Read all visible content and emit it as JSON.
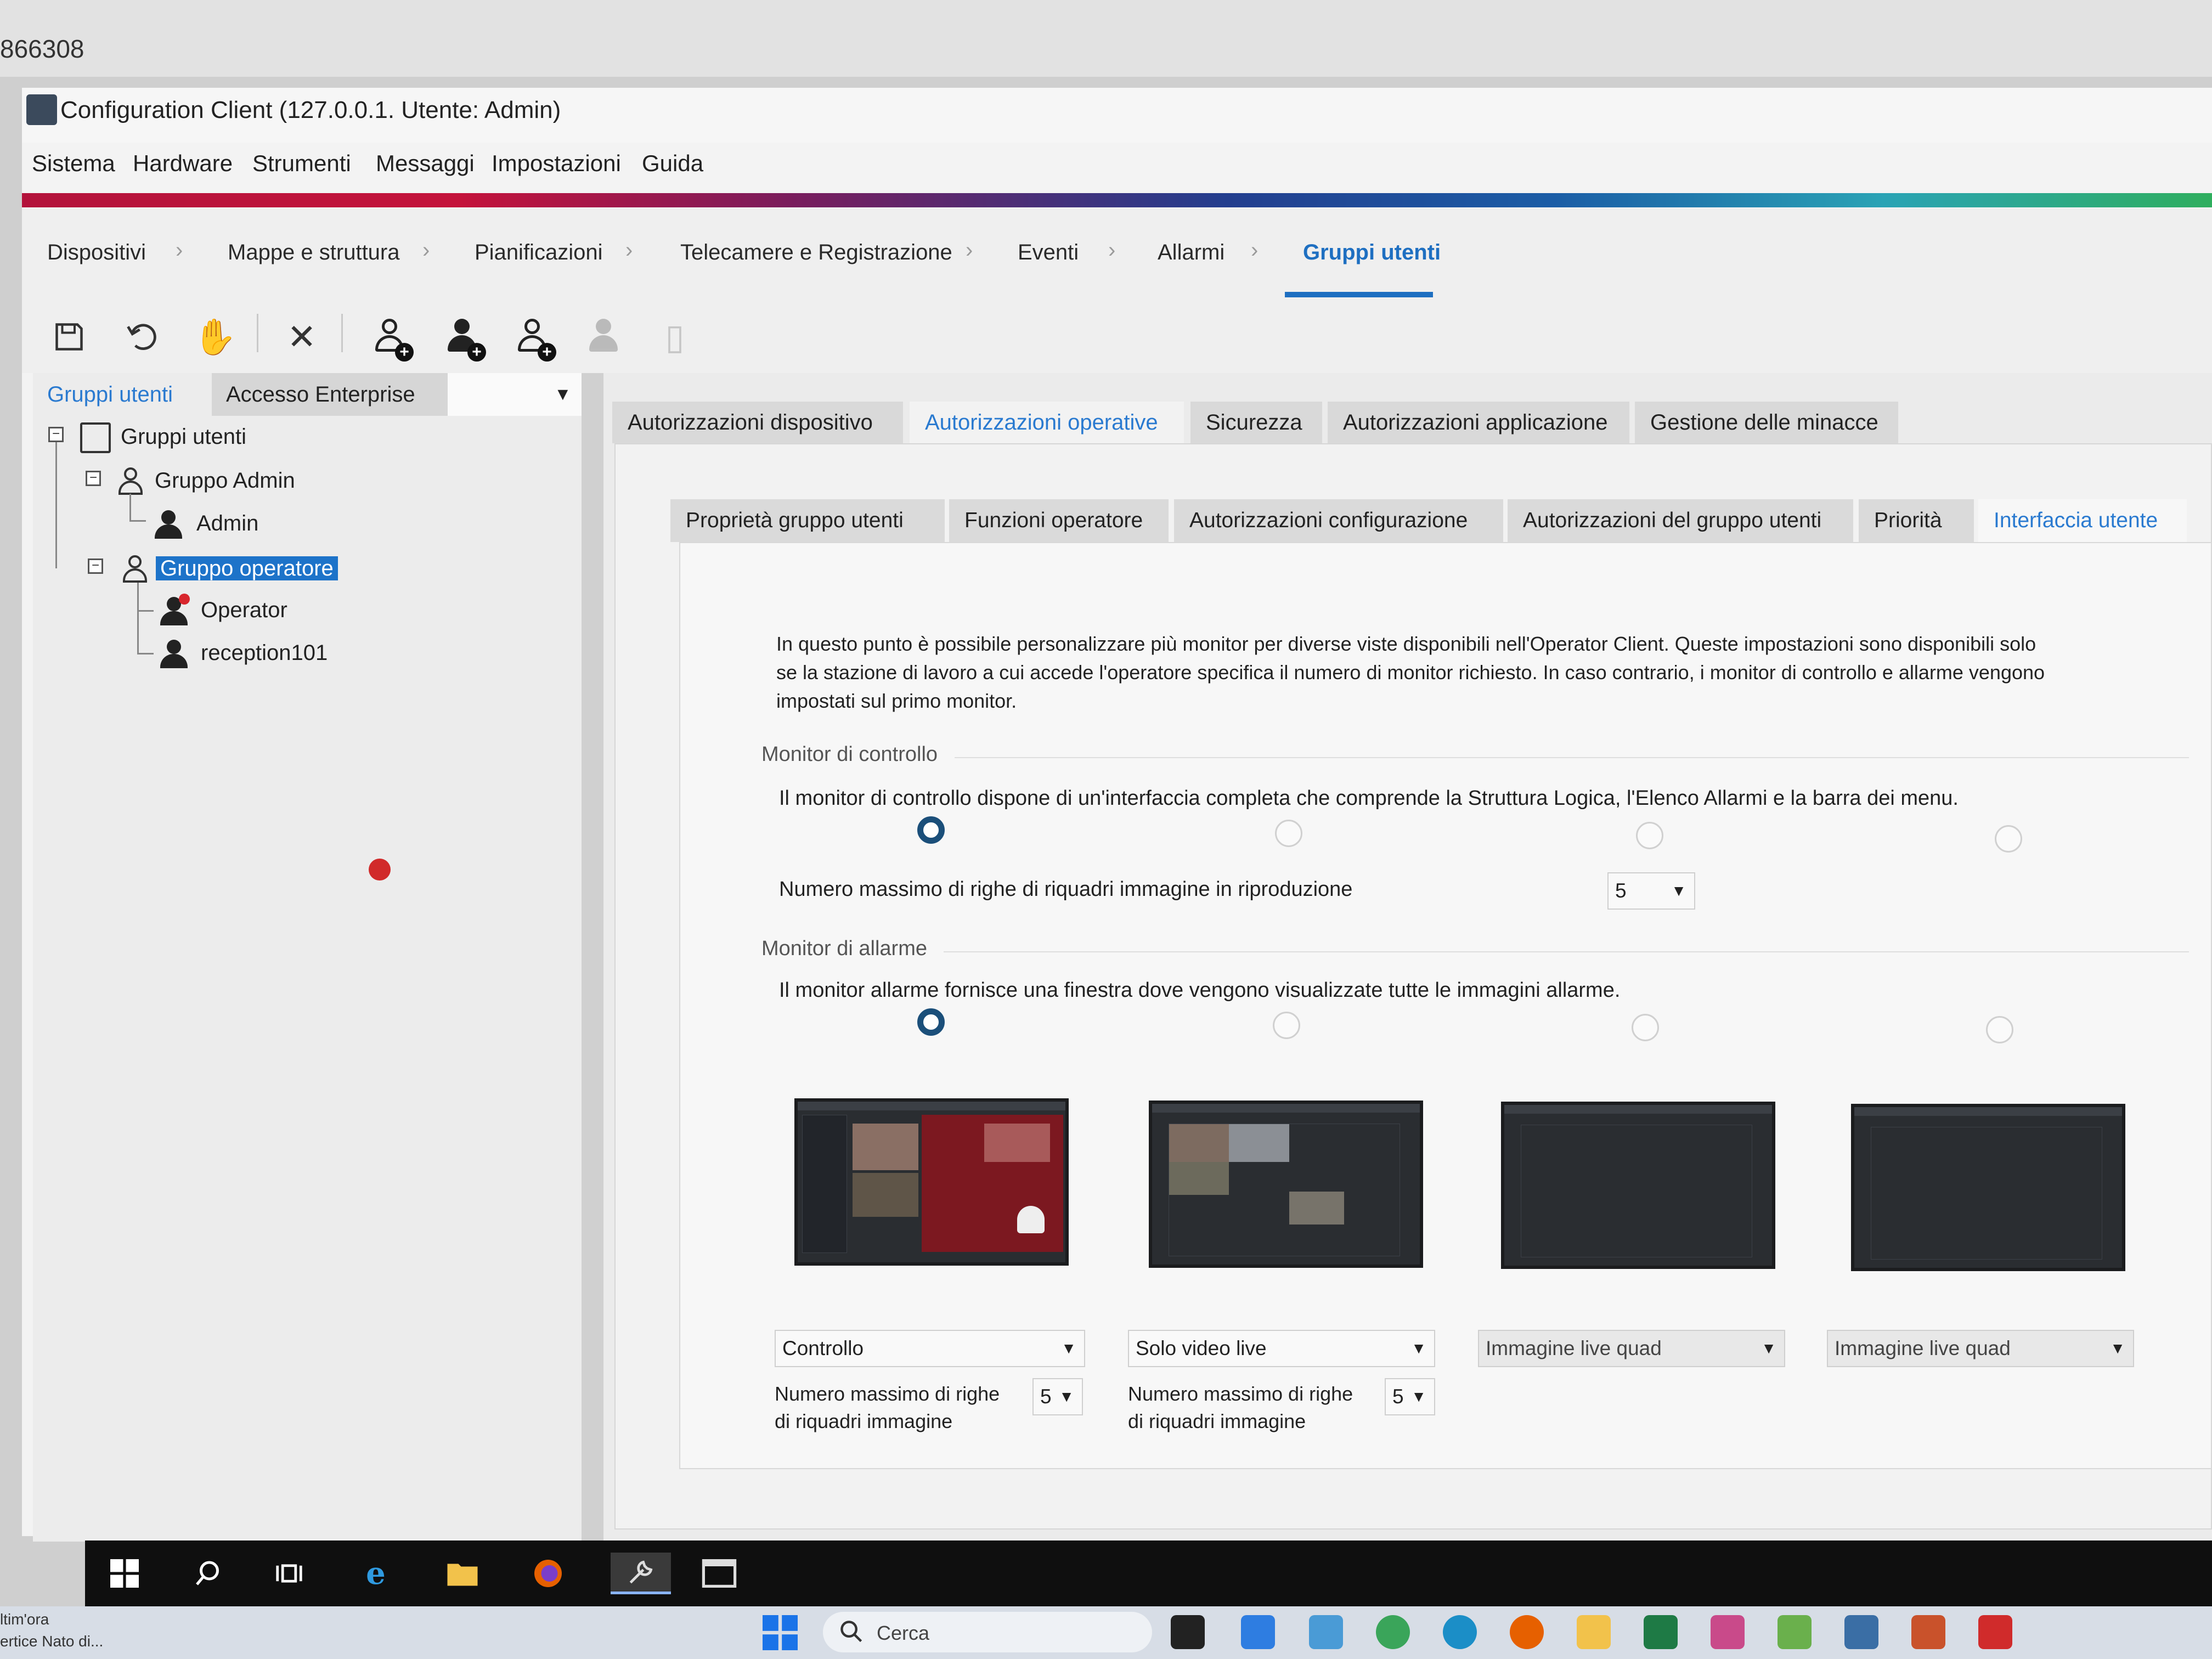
{
  "top_strip": {
    "text": "866308"
  },
  "window": {
    "title": "Configuration Client (127.0.0.1. Utente: Admin)"
  },
  "menu": [
    "Sistema",
    "Hardware",
    "Strumenti",
    "Messaggi",
    "Impostazioni",
    "Guida"
  ],
  "breadcrumbs": [
    "Dispositivi",
    "Mappe e struttura",
    "Pianificazioni",
    "Telecamere e Registrazione",
    "Eventi",
    "Allarmi",
    "Gruppi utenti"
  ],
  "breadcrumb_active": "Gruppi utenti",
  "toolbar": {
    "icons": [
      "save-icon",
      "undo-icon",
      "hand-icon",
      "delete-icon",
      "add-group-icon",
      "add-user-icon",
      "add-dual-auth-icon",
      "dual-group-icon",
      "copy-icon"
    ]
  },
  "left_panel": {
    "tabs": [
      "Gruppi utenti",
      "Accesso Enterprise"
    ],
    "tree": {
      "root": "Gruppi utenti",
      "groups": [
        {
          "label": "Gruppo Admin",
          "users": [
            "Admin"
          ]
        },
        {
          "label": "Gruppo operatore",
          "users": [
            "Operator",
            "reception101"
          ]
        }
      ]
    }
  },
  "outer_tabs": [
    "Autorizzazioni dispositivo",
    "Autorizzazioni operative",
    "Sicurezza",
    "Autorizzazioni applicazione",
    "Gestione delle minacce"
  ],
  "outer_active": "Autorizzazioni operative",
  "inner_tabs": [
    "Proprietà gruppo utenti",
    "Funzioni operatore",
    "Autorizzazioni configurazione",
    "Autorizzazioni del gruppo utenti",
    "Priorità",
    "Interfaccia utente"
  ],
  "inner_active": "Interfaccia utente",
  "content": {
    "description_line1": "In questo punto è possibile personalizzare più monitor per diverse viste disponibili nell'Operator Client. Queste impostazioni sono disponibili solo",
    "description_line2": "se la stazione di lavoro a cui accede l'operatore specifica il numero di monitor richiesto. In caso contrario, i monitor di controllo e allarme vengono",
    "description_line3": "impostati sul primo monitor.",
    "control_monitor": {
      "label": "Monitor di controllo",
      "text": "Il monitor di controllo dispone di un'interfaccia completa che comprende la Struttura Logica, l'Elenco Allarmi e la barra dei menu.",
      "selected_index": 0,
      "max_rows_label": "Numero massimo di righe di riquadri immagine in riproduzione",
      "max_rows_value": "5"
    },
    "alarm_monitor": {
      "label": "Monitor di allarme",
      "text": "Il monitor allarme fornisce una finestra dove vengono visualizzate tutte le immagini allarme.",
      "selected_index": 0
    },
    "monitors": [
      {
        "mode": "Controllo",
        "rows_label_1": "Numero massimo di righe",
        "rows_label_2": "di riquadri immagine",
        "rows_value": "5"
      },
      {
        "mode": "Solo video live",
        "rows_label_1": "Numero massimo di righe",
        "rows_label_2": "di riquadri immagine",
        "rows_value": "5"
      },
      {
        "mode": "Immagine live quad"
      },
      {
        "mode": "Immagine live quad"
      }
    ]
  },
  "taskbar": {
    "icons": [
      "windows-start-icon",
      "search-icon",
      "task-view-icon",
      "internet-explorer-icon",
      "file-explorer-icon",
      "firefox-icon",
      "config-client-icon",
      "console-icon"
    ]
  },
  "host_taskbar": {
    "search_placeholder": "Cerca",
    "left_text_1": "ltim'ora",
    "left_text_2": "ertice Nato di..."
  },
  "colors": {
    "accent": "#1e6fc1",
    "selection": "#1d73c9",
    "radio_selected": "#1b4f7a",
    "taskbar": "#0f0f0f"
  }
}
